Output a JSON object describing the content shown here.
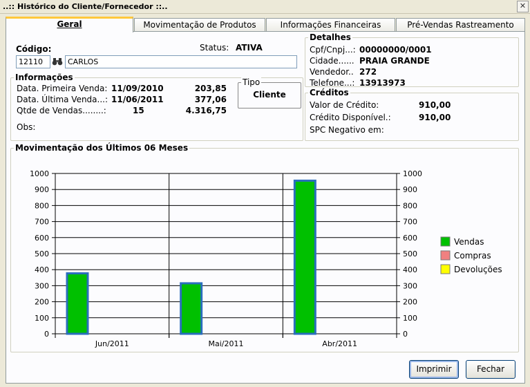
{
  "window": {
    "title": "..:: Histórico do Cliente/Fornecedor ::..",
    "close_glyph": "✕"
  },
  "tabs": [
    {
      "label": "Geral",
      "active": true
    },
    {
      "label": "Movimentação de Produtos",
      "active": false
    },
    {
      "label": "Informações Financeiras",
      "active": false
    },
    {
      "label": "Pré-Vendas Rastreamento",
      "active": false
    }
  ],
  "codigo": {
    "label": "Código:",
    "code": "12110",
    "name": "CARLOS",
    "search_icon": "binoculars-icon",
    "status_label": "Status:",
    "status_value": "ATIVA"
  },
  "informacoes": {
    "title": "Informações",
    "primeira_label": "Data. Primeira Venda:",
    "primeira_date": "11/09/2010",
    "primeira_value": "203,85",
    "ultima_label": "Data. Última Venda...:",
    "ultima_date": "11/06/2011",
    "ultima_value": "377,06",
    "qtde_label": "Qtde de Vendas........:",
    "qtde_count": "15",
    "qtde_value": "4.316,75",
    "obs_label": "Obs:",
    "tipo_title": "Tipo",
    "tipo_value": "Cliente"
  },
  "detalhes": {
    "title": "Detalhes",
    "cpf_label": "Cpf/Cnpj...:",
    "cpf_value": "00000000/0001",
    "cidade_label": "Cidade......",
    "cidade_value": "PRAIA GRANDE",
    "vendedor_label": "Vendedor..",
    "vendedor_value": "272",
    "telefone_label": "Telefone...:",
    "telefone_value": "13913973"
  },
  "creditos": {
    "title": "Créditos",
    "valor_label": "Valor de Crédito:",
    "valor_value": "910,00",
    "disp_label": "Crédito Disponível.:",
    "disp_value": "910,00",
    "spc_label": "SPC Negativo em:"
  },
  "chart_section": {
    "title": "Movimentação dos Últimos 06 Meses"
  },
  "chart_data": {
    "type": "bar",
    "categories": [
      "Jun/2011",
      "Mai/2011",
      "Abr/2011"
    ],
    "series": [
      {
        "name": "Vendas",
        "color": "#00c000",
        "values": [
          377,
          315,
          955
        ]
      },
      {
        "name": "Compras",
        "color": "#f08080",
        "values": [
          0,
          0,
          0
        ]
      },
      {
        "name": "Devoluções",
        "color": "#ffff00",
        "values": [
          0,
          0,
          0
        ]
      }
    ],
    "ylim": [
      0,
      1000
    ],
    "yticks": [
      0,
      100,
      200,
      300,
      400,
      500,
      600,
      700,
      800,
      900,
      1000
    ],
    "grid": true,
    "legend": "right"
  },
  "buttons": {
    "imprimir": "Imprimir",
    "fechar": "Fechar"
  }
}
